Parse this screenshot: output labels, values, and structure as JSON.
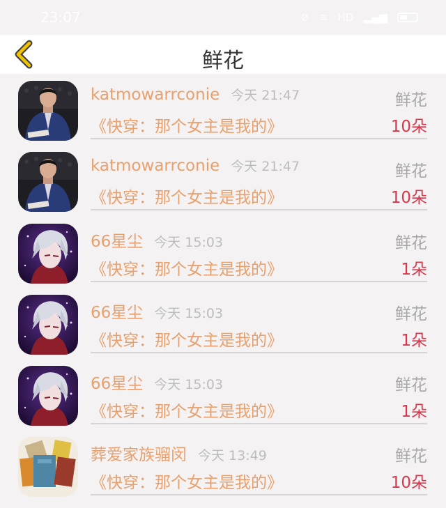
{
  "status_bar": {
    "time": "23:07",
    "network": "HD"
  },
  "header": {
    "title": "鲜花",
    "back_icon": "chevron-left-icon",
    "accent": "#f2c400"
  },
  "records": [
    {
      "avatar": "avatar-man-jacket",
      "user": "katmowarrconie",
      "time": "今天 21:47",
      "type": "鲜花",
      "book": "《快穿：那个女主是我的》",
      "count": "10朵"
    },
    {
      "avatar": "avatar-man-jacket",
      "user": "katmowarrconie",
      "time": "今天 21:47",
      "type": "鲜花",
      "book": "《快穿：那个女主是我的》",
      "count": "10朵"
    },
    {
      "avatar": "avatar-anime-silver",
      "user": "66星尘",
      "time": "今天 15:03",
      "type": "鲜花",
      "book": "《快穿：那个女主是我的》",
      "count": "1朵"
    },
    {
      "avatar": "avatar-anime-silver",
      "user": "66星尘",
      "time": "今天 15:03",
      "type": "鲜花",
      "book": "《快穿：那个女主是我的》",
      "count": "1朵"
    },
    {
      "avatar": "avatar-anime-silver",
      "user": "66星尘",
      "time": "今天 15:03",
      "type": "鲜花",
      "book": "《快穿：那个女主是我的》",
      "count": "1朵"
    },
    {
      "avatar": "avatar-notebooks",
      "user": "葬爱家族骝闵",
      "time": "今天 13:49",
      "type": "鲜花",
      "book": "《快穿：那个女主是我的》",
      "count": "10朵"
    }
  ],
  "colors": {
    "name": "#e8a16e",
    "count": "#d9364c",
    "muted": "#a8a8a8"
  }
}
